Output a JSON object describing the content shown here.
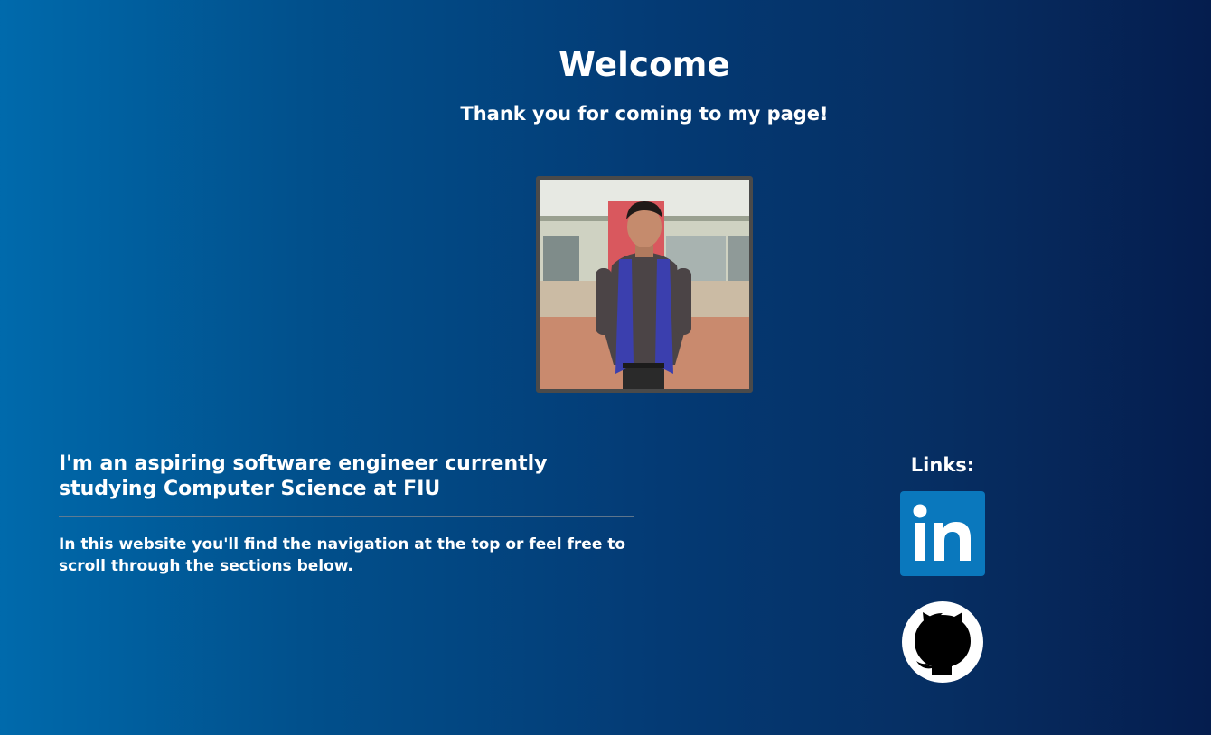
{
  "hero": {
    "title": "Welcome",
    "subtitle": "Thank you for coming to my page!"
  },
  "intro": {
    "heading": "I'm an aspiring software engineer currently studying Computer Science at FIU",
    "text": "In this website you'll find the navigation at the top or feel free to scroll through the sections below."
  },
  "links": {
    "label": "Links:",
    "items": [
      {
        "name": "linkedin",
        "icon": "linkedin-icon",
        "color": "#0a78bd"
      },
      {
        "name": "github",
        "icon": "github-icon",
        "color": "#000000"
      }
    ]
  },
  "colors": {
    "background_start": "#006aac",
    "background_end": "#051d4e",
    "text": "#ffffff",
    "photo_border": "#4a4a4a"
  }
}
